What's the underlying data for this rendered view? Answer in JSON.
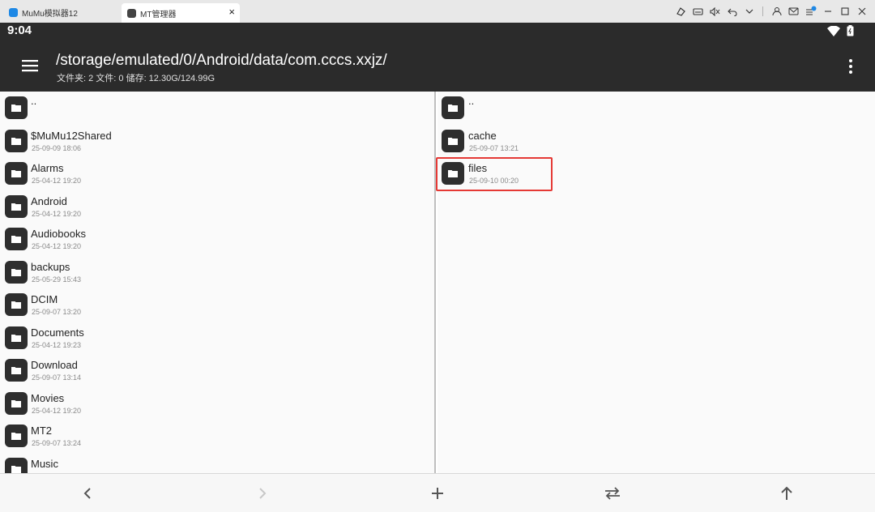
{
  "window": {
    "tabs": [
      {
        "label": "MuMu模拟器12",
        "active": false
      },
      {
        "label": "MT管理器",
        "active": true
      }
    ]
  },
  "status": {
    "time": "9:04"
  },
  "header": {
    "path": "/storage/emulated/0/Android/data/com.cccs.xxjz/",
    "stats": "文件夹: 2  文件: 0  储存: 12.30G/124.99G"
  },
  "left_pane": {
    "items": [
      {
        "name": "..",
        "date": ""
      },
      {
        "name": "$MuMu12Shared",
        "date": "25-09-09 18:06"
      },
      {
        "name": "Alarms",
        "date": "25-04-12 19:20"
      },
      {
        "name": "Android",
        "date": "25-04-12 19:20"
      },
      {
        "name": "Audiobooks",
        "date": "25-04-12 19:20"
      },
      {
        "name": "backups",
        "date": "25-05-29 15:43"
      },
      {
        "name": "DCIM",
        "date": "25-09-07 13:20"
      },
      {
        "name": "Documents",
        "date": "25-04-12 19:23"
      },
      {
        "name": "Download",
        "date": "25-09-07 13:14"
      },
      {
        "name": "Movies",
        "date": "25-04-12 19:20"
      },
      {
        "name": "MT2",
        "date": "25-09-07 13:24"
      },
      {
        "name": "Music",
        "date": ""
      }
    ]
  },
  "right_pane": {
    "items": [
      {
        "name": "..",
        "date": ""
      },
      {
        "name": "cache",
        "date": "25-09-07 13:21"
      },
      {
        "name": "files",
        "date": "25-09-10 00:20"
      }
    ]
  },
  "colors": {
    "appbar": "#2b2b2b",
    "folder_icon": "#2e2e2e",
    "highlight": "#e53935"
  }
}
